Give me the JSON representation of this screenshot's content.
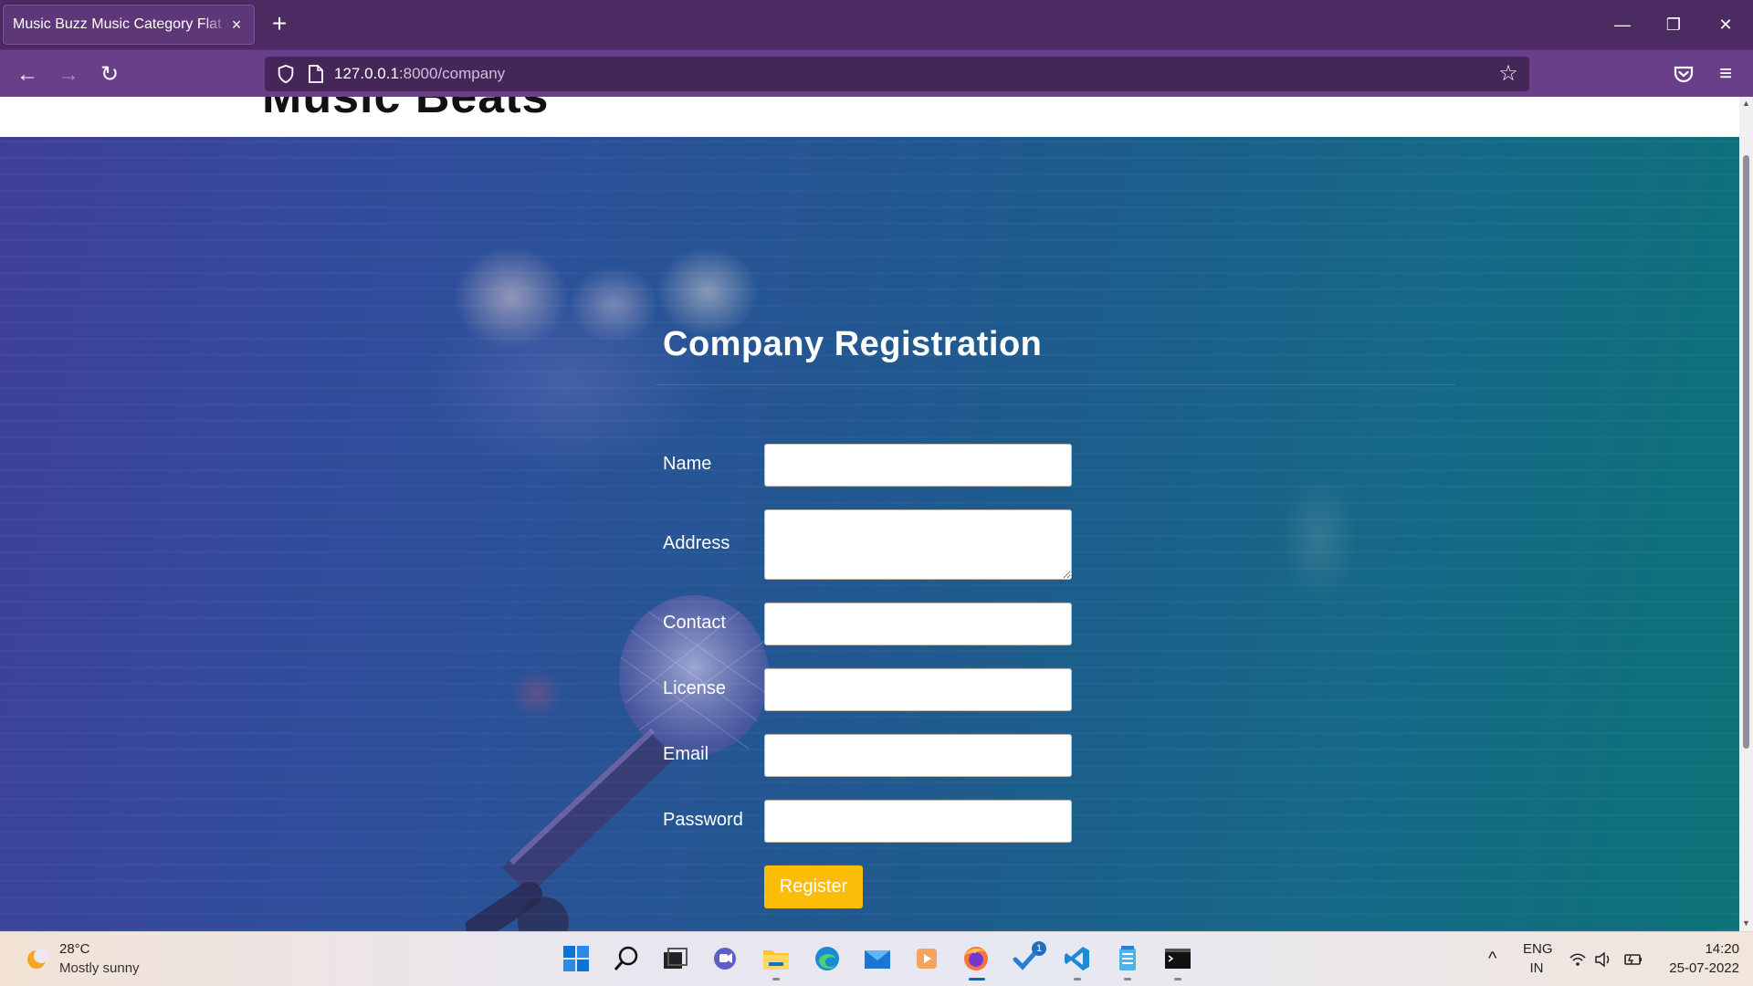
{
  "browser": {
    "tab_title": "Music Buzz Music Category Flat Bootstrap Responsive",
    "tab_close": "×",
    "new_tab": "+",
    "url_host": "127.0.0.1",
    "url_path": ":8000/company",
    "window_minimize": "—",
    "window_restore": "❐",
    "window_close": "✕",
    "back": "←",
    "forward": "→",
    "reload": "↻",
    "bookmark": "☆",
    "menu": "≡"
  },
  "site": {
    "logo": "Music Beats"
  },
  "form": {
    "title": "Company Registration",
    "fields": [
      {
        "label": "Name",
        "value": ""
      },
      {
        "label": "Address",
        "value": ""
      },
      {
        "label": "Contact",
        "value": ""
      },
      {
        "label": "License",
        "value": ""
      },
      {
        "label": "Email",
        "value": ""
      },
      {
        "label": "Password",
        "value": ""
      }
    ],
    "submit_label": "Register"
  },
  "colors": {
    "submit": "#fbbd08",
    "browser_chrome": "#4c2a62"
  },
  "taskbar": {
    "weather_temp": "28°C",
    "weather_desc": "Mostly sunny",
    "icons": [
      "start-icon",
      "search-icon",
      "task-view-icon",
      "chat-icon",
      "file-explorer-icon",
      "edge-icon",
      "mail-icon",
      "media-player-icon",
      "firefox-icon",
      "todo-icon",
      "vscode-icon",
      "notepad-icon",
      "terminal-icon"
    ],
    "todo_badge": "1",
    "language": "ENG",
    "region": "IN",
    "time": "14:20",
    "date": "25-07-2022",
    "tray_arrow": "^"
  }
}
